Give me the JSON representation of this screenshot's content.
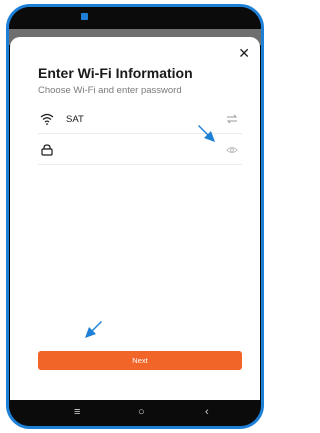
{
  "header": {
    "title": "Enter Wi-Fi Information",
    "subtitle": "Choose Wi-Fi and enter password"
  },
  "wifi": {
    "ssid": "SAT",
    "icon": "wifi-icon",
    "switch_icon": "swap-networks-icon"
  },
  "password": {
    "value": "",
    "placeholder": "",
    "icon": "lock-icon",
    "visibility_icon": "eye-icon"
  },
  "actions": {
    "next_label": "Next"
  },
  "nav": {
    "items": [
      "menu-icon",
      "home-circle-icon",
      "back-chevron-icon"
    ]
  },
  "colors": {
    "accent": "#f26528",
    "frame": "#1e7fd6",
    "annotation_arrow": "#1e7fd6"
  }
}
